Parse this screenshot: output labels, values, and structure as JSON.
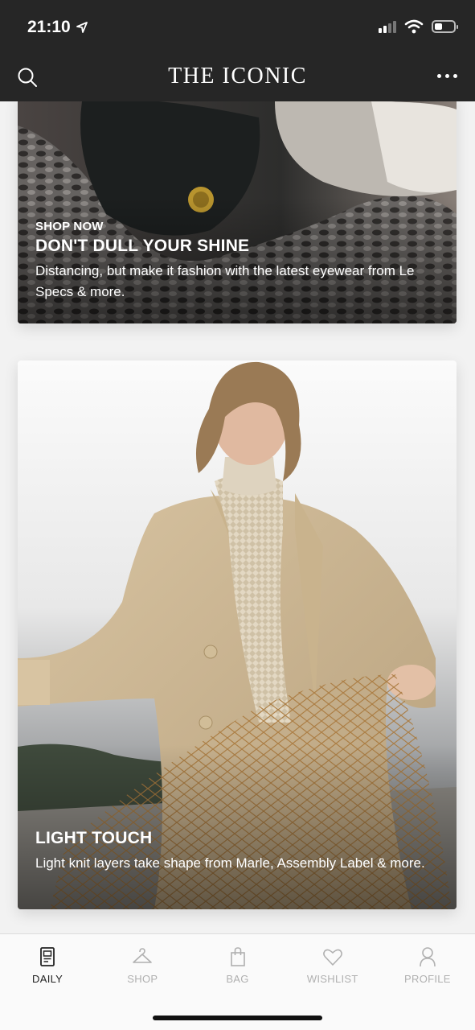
{
  "status_bar": {
    "time": "21:10"
  },
  "header": {
    "title": "THE ICONIC",
    "search_icon": "search-icon",
    "more_icon": "more-icon"
  },
  "feed": {
    "cards": [
      {
        "eyebrow": "SHOP NOW",
        "title": "DON'T DULL YOUR SHINE",
        "description": "Distancing, but make it fashion with the latest eyewear from Le Specs & more."
      },
      {
        "eyebrow": "",
        "title": "LIGHT TOUCH",
        "description": "Light knit layers take shape from Marle, Assembly Label & more."
      }
    ]
  },
  "nav": {
    "items": [
      {
        "label": "DAILY",
        "icon": "daily-icon",
        "active": true
      },
      {
        "label": "SHOP",
        "icon": "hanger-icon",
        "active": false
      },
      {
        "label": "BAG",
        "icon": "bag-icon",
        "active": false
      },
      {
        "label": "WISHLIST",
        "icon": "heart-icon",
        "active": false
      },
      {
        "label": "PROFILE",
        "icon": "profile-icon",
        "active": false
      }
    ]
  },
  "colors": {
    "header_bg": "#262626",
    "nav_active": "#222222",
    "nav_inactive": "#b0b0b0"
  }
}
